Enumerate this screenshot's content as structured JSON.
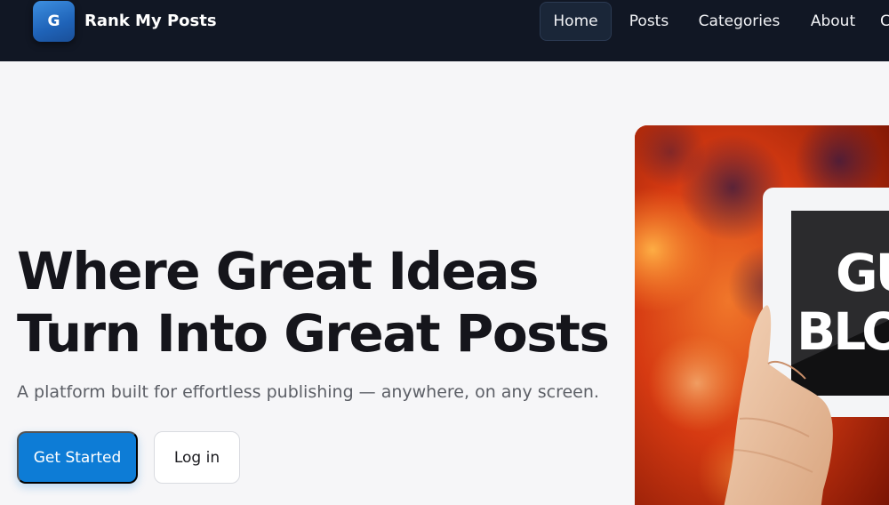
{
  "brand": {
    "logo_letter": "G",
    "name": "Rank My Posts"
  },
  "nav": {
    "items": [
      {
        "label": "Home",
        "active": true
      },
      {
        "label": "Posts",
        "active": false
      },
      {
        "label": "Categories",
        "active": false
      },
      {
        "label": "About",
        "active": false
      },
      {
        "label": "C",
        "active": false
      }
    ]
  },
  "hero": {
    "title_line1": "Where Great Ideas",
    "title_line2": "Turn Into Great Posts",
    "subtitle": "A platform built for effortless publishing — anywhere, on any screen.",
    "primary_button": "Get Started",
    "secondary_button": "Log in",
    "image_text_line1": "GU",
    "image_text_line2": "BLO"
  },
  "colors": {
    "navbar_bg": "#111724",
    "primary": "#0d7cd6",
    "page_bg": "#f6f6f8",
    "heading": "#15151b"
  }
}
